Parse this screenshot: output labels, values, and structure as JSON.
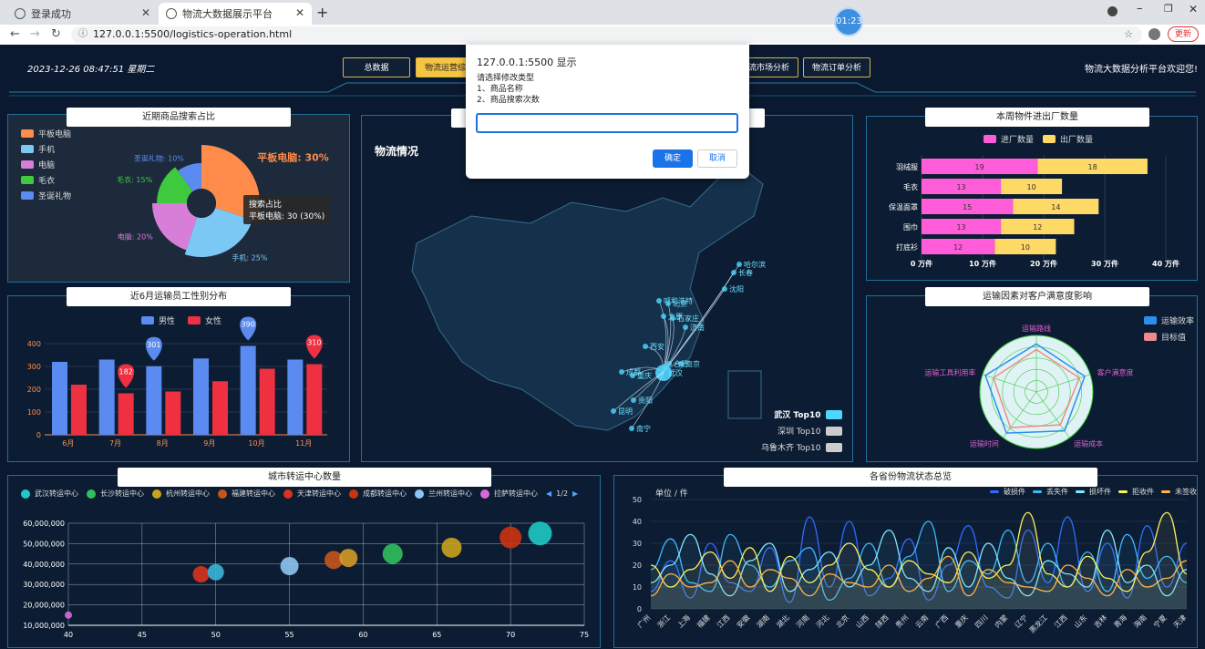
{
  "browser": {
    "tabs": [
      {
        "label": "登录成功"
      },
      {
        "label": "物流大数据展示平台"
      }
    ],
    "url": "127.0.0.1:5500/logistics-operation.html",
    "timer": "01:23",
    "update_label": "更新"
  },
  "header": {
    "datetime": "2023-12-26  08:47:51  星期二",
    "nav": [
      "总数据",
      "物流运营综合",
      "物流市场分析",
      "物流订单分析"
    ],
    "welcome": "物流大数据分析平台欢迎您!"
  },
  "dialog": {
    "title": "127.0.0.1:5500 显示",
    "lines": [
      "请选择修改类型",
      "1、商品名称",
      "2、商品搜索次数"
    ],
    "input_value": "",
    "ok_label": "确定",
    "cancel_label": "取消"
  },
  "panels": {
    "search_share": {
      "title": "近期商品搜索占比",
      "legend": [
        "平板电脑",
        "手机",
        "电脑",
        "毛衣",
        "圣诞礼物"
      ],
      "labels": [
        "平板电脑: 30%",
        "手机: 25%",
        "电脑: 20%",
        "毛衣: 15%",
        "圣诞礼物: 10%"
      ],
      "tooltip_title": "搜索占比",
      "tooltip_value": "平板电脑: 30 (30%)"
    },
    "gender": {
      "title": "近6月运输员工性别分布",
      "legend": [
        "男性",
        "女性"
      ],
      "yticks": [
        "0",
        "100",
        "200",
        "300",
        "400"
      ],
      "months": [
        "6月",
        "7月",
        "8月",
        "9月",
        "10月",
        "11月"
      ],
      "pins": [
        "301",
        "182",
        "390",
        "310"
      ]
    },
    "map": {
      "title": "物流情况",
      "cities": [
        "哈尔滨",
        "长春",
        "沈阳",
        "呼和浩特",
        "北京",
        "太原",
        "石家庄",
        "济南",
        "西安",
        "南京",
        "合肥",
        "成都",
        "重庆",
        "武汉",
        "贵阳",
        "昆明",
        "南宁"
      ],
      "legend": [
        "武汉 Top10",
        "深圳 Top10",
        "乌鲁木齐 Top10"
      ]
    },
    "weekly": {
      "title": "本周物件进出厂数量",
      "legend": [
        "进厂数量",
        "出厂数量"
      ],
      "items": [
        "羽绒服",
        "毛衣",
        "保温面罩",
        "围巾",
        "打底衫"
      ],
      "xticks": [
        "0 万件",
        "10 万件",
        "20 万件",
        "30 万件",
        "40 万件"
      ]
    },
    "radar": {
      "title": "运输因素对客户满意度影响",
      "legend": [
        "运输效率",
        "目标值"
      ],
      "indicators": [
        "运输路线",
        "客户满意度",
        "运输成本",
        "运输时间",
        "运输工具利用率"
      ]
    },
    "centers": {
      "title": "城市转运中心数量",
      "legend": [
        "武汉转运中心",
        "长沙转运中心",
        "杭州转运中心",
        "福建转运中心",
        "天津转运中心",
        "成都转运中心",
        "兰州转运中心",
        "拉萨转运中心"
      ],
      "page": "1/2",
      "yticks": [
        "60,000,000",
        "50,000,000",
        "40,000,000",
        "30,000,000",
        "20,000,000",
        "10,000,000"
      ],
      "xticks": [
        "40",
        "45",
        "50",
        "55",
        "60",
        "65",
        "70",
        "75"
      ]
    },
    "province": {
      "title": "各省份物流状态总览",
      "unit": "单位 / 件",
      "legend": [
        "破损件",
        "丢失件",
        "损坏件",
        "拒收件",
        "未签收"
      ],
      "yticks": [
        "50",
        "40",
        "30",
        "20",
        "10",
        "0"
      ],
      "provinces": [
        "广州",
        "浙江",
        "上海",
        "福建",
        "江西",
        "安徽",
        "湖南",
        "湖北",
        "河南",
        "河北",
        "北京",
        "山西",
        "陕西",
        "贵州",
        "云南",
        "广西",
        "重庆",
        "四川",
        "内蒙",
        "辽宁",
        "黑龙江",
        "江西",
        "山东",
        "吉林",
        "青海",
        "海南",
        "宁夏",
        "天津"
      ]
    }
  },
  "chart_data": [
    {
      "type": "pie",
      "title": "近期商品搜索占比",
      "categories": [
        "平板电脑",
        "手机",
        "电脑",
        "毛衣",
        "圣诞礼物"
      ],
      "values": [
        30,
        25,
        20,
        15,
        10
      ],
      "colors": [
        "#ff8c4a",
        "#7cc8f5",
        "#d77fd8",
        "#3ec93e",
        "#5b8bf0"
      ]
    },
    {
      "type": "bar",
      "title": "近6月运输员工性别分布",
      "categories": [
        "6月",
        "7月",
        "8月",
        "9月",
        "10月",
        "11月"
      ],
      "series": [
        {
          "name": "男性",
          "values": [
            320,
            330,
            301,
            335,
            390,
            330
          ],
          "color": "#5b8bf0"
        },
        {
          "name": "女性",
          "values": [
            220,
            182,
            190,
            235,
            290,
            310
          ],
          "color": "#ee3040"
        }
      ],
      "ylim": [
        0,
        400
      ]
    },
    {
      "type": "bar",
      "title": "本周物件进出厂数量",
      "categories": [
        "羽绒服",
        "毛衣",
        "保温面罩",
        "围巾",
        "打底衫"
      ],
      "series": [
        {
          "name": "进厂数量",
          "values": [
            19,
            13,
            15,
            13,
            12
          ],
          "color": "#ff5cd9"
        },
        {
          "name": "出厂数量",
          "values": [
            18,
            10,
            14,
            12,
            10
          ],
          "color": "#ffd966"
        }
      ],
      "xlim": [
        0,
        40
      ]
    },
    {
      "type": "scatter",
      "title": "城市转运中心数量",
      "points": [
        {
          "x": 40,
          "y": 15000000,
          "r": 4,
          "color": "#d76ad8"
        },
        {
          "x": 49,
          "y": 35000000,
          "r": 9,
          "color": "#d9341c"
        },
        {
          "x": 50,
          "y": 36000000,
          "r": 9,
          "color": "#3ab6d8"
        },
        {
          "x": 55,
          "y": 39000000,
          "r": 10,
          "color": "#8ec5f0"
        },
        {
          "x": 58,
          "y": 42000000,
          "r": 10,
          "color": "#c4561b"
        },
        {
          "x": 59,
          "y": 43000000,
          "r": 10,
          "color": "#d49a27"
        },
        {
          "x": 62,
          "y": 45000000,
          "r": 11,
          "color": "#31c05c"
        },
        {
          "x": 66,
          "y": 48000000,
          "r": 11,
          "color": "#c9a21e"
        },
        {
          "x": 70,
          "y": 53000000,
          "r": 12,
          "color": "#cc3310"
        },
        {
          "x": 72,
          "y": 55000000,
          "r": 13,
          "color": "#1fc9c4"
        }
      ],
      "xlim": [
        40,
        75
      ],
      "ylim": [
        10000000,
        60000000
      ]
    },
    {
      "type": "line",
      "title": "各省份物流状态总览",
      "series": [
        {
          "name": "破损件",
          "color": "#2f6bff",
          "values": [
            8,
            22,
            5,
            30,
            12,
            8,
            28,
            3,
            42,
            10,
            40,
            6,
            14,
            32,
            4,
            20,
            38,
            10,
            5,
            36,
            12,
            42,
            8,
            30,
            5,
            38,
            10,
            30
          ]
        },
        {
          "name": "丢失件",
          "color": "#3fb8ff",
          "values": [
            18,
            32,
            12,
            8,
            34,
            20,
            10,
            22,
            28,
            4,
            14,
            30,
            10,
            24,
            40,
            8,
            22,
            16,
            36,
            12,
            30,
            10,
            26,
            8,
            34,
            14,
            24,
            12
          ]
        },
        {
          "name": "损坏件",
          "color": "#7fe8ff",
          "values": [
            12,
            20,
            34,
            16,
            6,
            22,
            30,
            8,
            18,
            26,
            10,
            20,
            36,
            14,
            8,
            28,
            10,
            30,
            14,
            6,
            22,
            16,
            10,
            36,
            12,
            20,
            6,
            18
          ]
        },
        {
          "name": "拒收件",
          "color": "#fff25a",
          "values": [
            20,
            10,
            18,
            26,
            14,
            28,
            8,
            24,
            12,
            20,
            30,
            18,
            10,
            22,
            16,
            12,
            26,
            14,
            20,
            44,
            16,
            10,
            24,
            14,
            8,
            26,
            44,
            16
          ]
        },
        {
          "name": "未签收",
          "color": "#ffb347",
          "values": [
            6,
            16,
            10,
            12,
            22,
            10,
            18,
            14,
            6,
            16,
            12,
            10,
            20,
            8,
            14,
            24,
            6,
            18,
            12,
            10,
            8,
            20,
            14,
            6,
            18,
            10,
            14,
            22
          ]
        }
      ],
      "ylim": [
        0,
        50
      ]
    }
  ]
}
